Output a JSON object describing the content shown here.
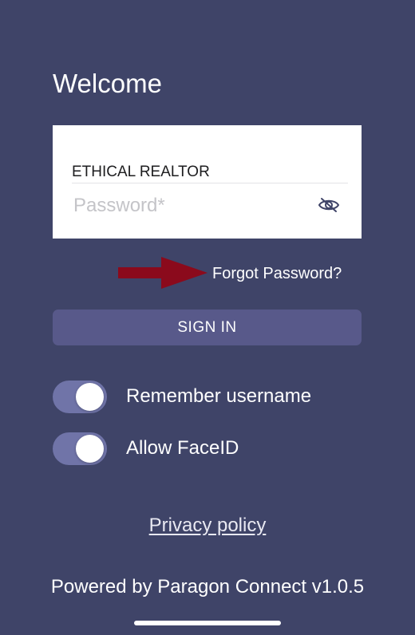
{
  "login": {
    "title": "Welcome",
    "username_value": "ETHICAL REALTOR",
    "password_placeholder": "Password*",
    "password_toggle_icon": "eye-slash-icon",
    "forgot_password": "Forgot Password?",
    "sign_in": "SIGN IN"
  },
  "annotation": {
    "arrow_icon": "right-arrow-icon",
    "arrow_color": "#8b0a1c"
  },
  "settings": {
    "remember_username": {
      "label": "Remember username",
      "enabled": true
    },
    "allow_faceid": {
      "label": "Allow FaceID",
      "enabled": true
    }
  },
  "footer": {
    "privacy_policy": "Privacy policy",
    "powered_by": "Powered by Paragon Connect v1.0.5"
  },
  "colors": {
    "background": "#3f4468",
    "button": "#58598a",
    "switch_on": "#7074a8"
  }
}
